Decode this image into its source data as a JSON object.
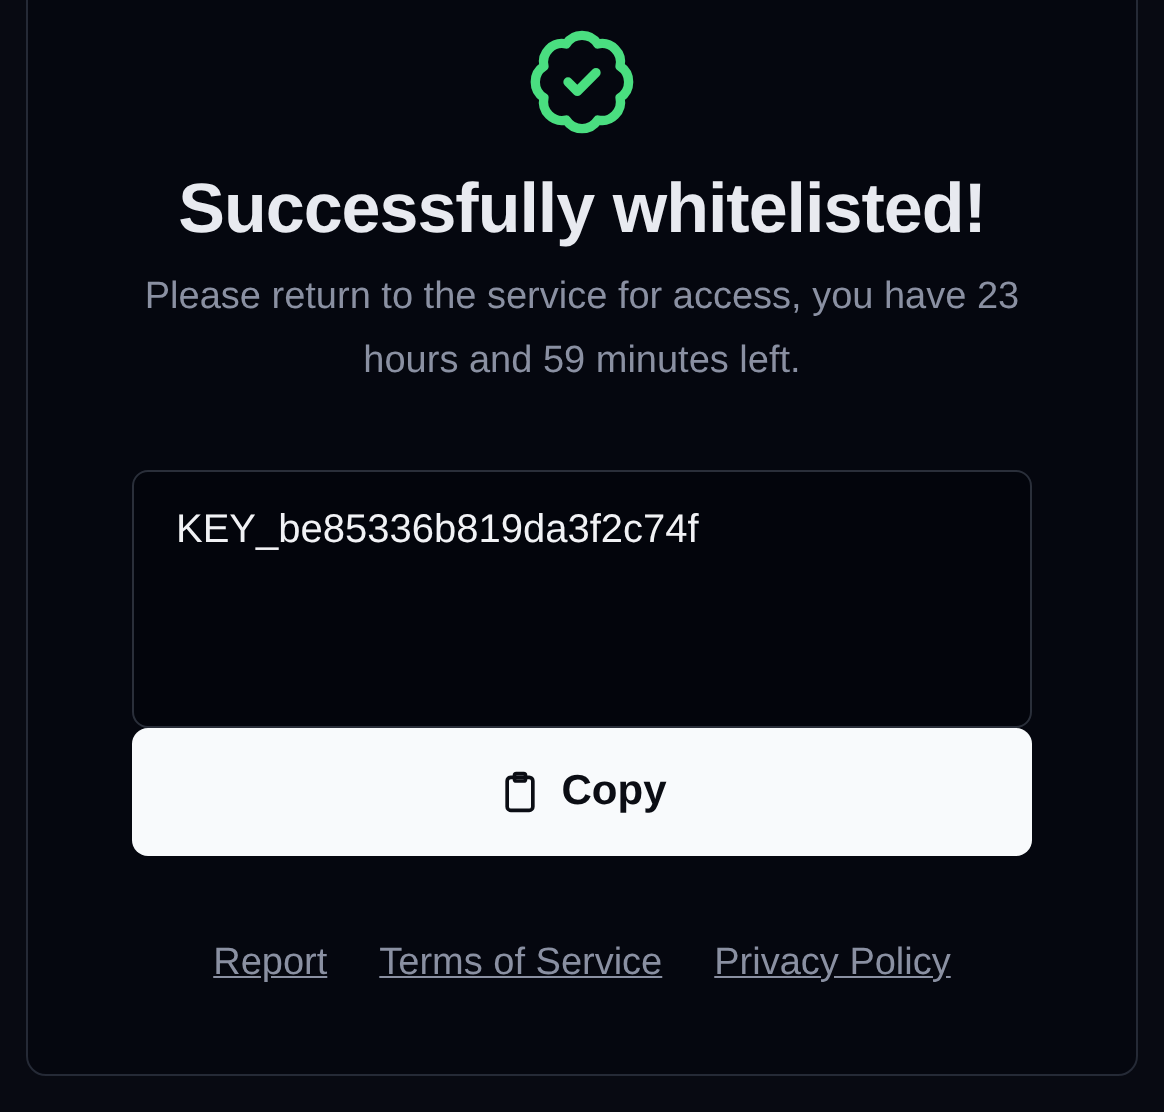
{
  "title": "Successfully whitelisted!",
  "message": "Please return to the service for access, you have 23 hours and 59 minutes left.",
  "key_field": {
    "value": "KEY_be85336b819da3f2c74f"
  },
  "copy_button": {
    "label": "Copy"
  },
  "footer_links": [
    "Report",
    "Terms of Service",
    "Privacy Policy"
  ]
}
